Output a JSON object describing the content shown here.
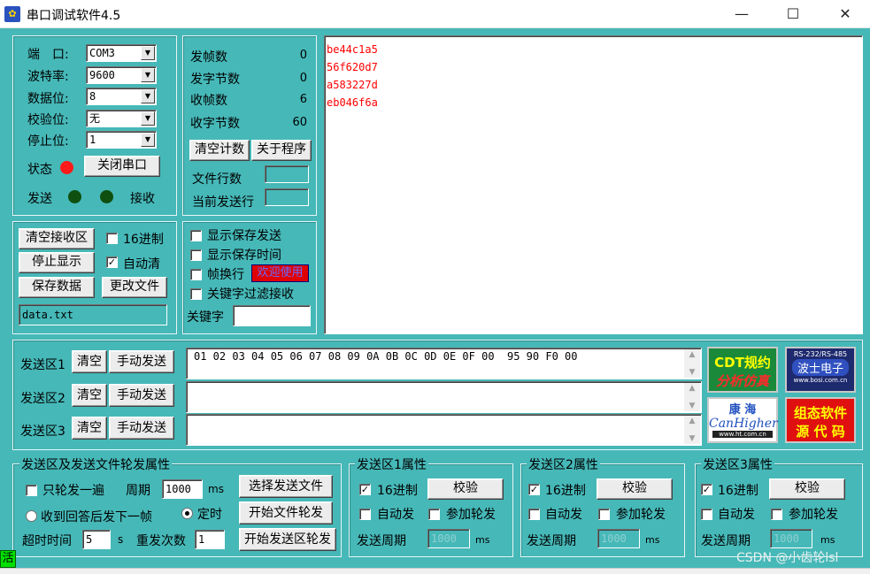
{
  "window": {
    "title": "串口调试软件4.5",
    "icon": "app-icon",
    "minimize": "—",
    "maximize": "☐",
    "close": "✕"
  },
  "port": {
    "port_label": "端　口:",
    "port_value": "COM3",
    "baud_label": "波特率:",
    "baud_value": "9600",
    "databits_label": "数据位:",
    "databits_value": "8",
    "parity_label": "校验位:",
    "parity_value": "无",
    "stopbits_label": "停止位:",
    "stopbits_value": "1",
    "status_label": "状态",
    "status_color": "#ff1a1a",
    "close_port_button": "关闭串口",
    "send_label": "发送",
    "recv_label": "接收",
    "led_color": "#0f4f0f"
  },
  "counters": {
    "sent_frames_label": "发帧数",
    "sent_frames": "0",
    "sent_bytes_label": "发字节数",
    "sent_bytes": "0",
    "recv_frames_label": "收帧数",
    "recv_frames": "6",
    "recv_bytes_label": "收字节数",
    "recv_bytes": "60",
    "clear_count_button": "清空计数",
    "about_button": "关于程序",
    "file_lines_label": "文件行数",
    "current_line_label": "当前发送行"
  },
  "receive_ops": {
    "clear_button": "清空接收区",
    "hex_label": "16进制",
    "hex_checked": false,
    "stop_button": "停止显示",
    "auto_clear_label": "自动清",
    "auto_clear_checked": true,
    "save_button": "保存数据",
    "change_file_button": "更改文件",
    "filename": "data.txt"
  },
  "display_opts": {
    "show_save_send": "显示保存发送",
    "show_save_time": "显示保存时间",
    "frame_newline": "帧换行",
    "welcome_badge": "欢迎使用",
    "keyword_filter": "关键字过滤接收",
    "keyword_label": "关键字",
    "keyword_value": ""
  },
  "receive_area": {
    "lines": [
      "be44c1a5",
      "56f620d7",
      "a583227d",
      "eb046f6a"
    ],
    "text_color": "#ff0000"
  },
  "send_areas": [
    {
      "label": "发送区1",
      "clear": "清空",
      "send": "手动发送",
      "content": "01 02 03 04 05 06 07 08 09 0A 0B 0C 0D 0E 0F 00  95 90 F0 00"
    },
    {
      "label": "发送区2",
      "clear": "清空",
      "send": "手动发送",
      "content": ""
    },
    {
      "label": "发送区3",
      "clear": "清空",
      "send": "手动发送",
      "content": ""
    }
  ],
  "ads": {
    "cdt_line1": "CDT规约",
    "cdt_line2": "分析仿真",
    "bosi_top": "RS-232/RS-485",
    "bosi_mid": "波士电子",
    "bosi_url": "www.bosi.com.cn",
    "kanghai_cn": "康 海",
    "kanghai_en": "CanHigher",
    "kanghai_url": "www.ht.com.cn",
    "source_line1": "组态软件",
    "source_line2": "源 代 码"
  },
  "rotation": {
    "title": "发送区及发送文件轮发属性",
    "once_label": "只轮发一遍",
    "once_checked": false,
    "period_label": "周期",
    "period_value": "1000",
    "ms": "ms",
    "select_file_button": "选择发送文件",
    "reply_next_label": "收到回答后发下一帧",
    "timed_label": "定时",
    "timed_selected": true,
    "start_file_button": "开始文件轮发",
    "timeout_label": "超时时间",
    "timeout_value": "5",
    "s": "s",
    "resend_label": "重发次数",
    "resend_value": "1",
    "start_area_button": "开始发送区轮发"
  },
  "area_props": [
    {
      "title": "发送区1属性",
      "hex": "16进制",
      "hex_checked": true,
      "verify": "校验",
      "auto_send": "自动发",
      "join_rotation": "参加轮发",
      "period_label": "发送周期",
      "period_value": "1000",
      "ms": "ms"
    },
    {
      "title": "发送区2属性",
      "hex": "16进制",
      "hex_checked": true,
      "verify": "校验",
      "auto_send": "自动发",
      "join_rotation": "参加轮发",
      "period_label": "发送周期",
      "period_value": "1000",
      "ms": "ms"
    },
    {
      "title": "发送区3属性",
      "hex": "16进制",
      "hex_checked": true,
      "verify": "校验",
      "auto_send": "自动发",
      "join_rotation": "参加轮发",
      "period_label": "发送周期",
      "period_value": "1000",
      "ms": "ms"
    }
  ],
  "footer": {
    "status_char": "活",
    "watermark": "CSDN @小齿轮lsl"
  }
}
